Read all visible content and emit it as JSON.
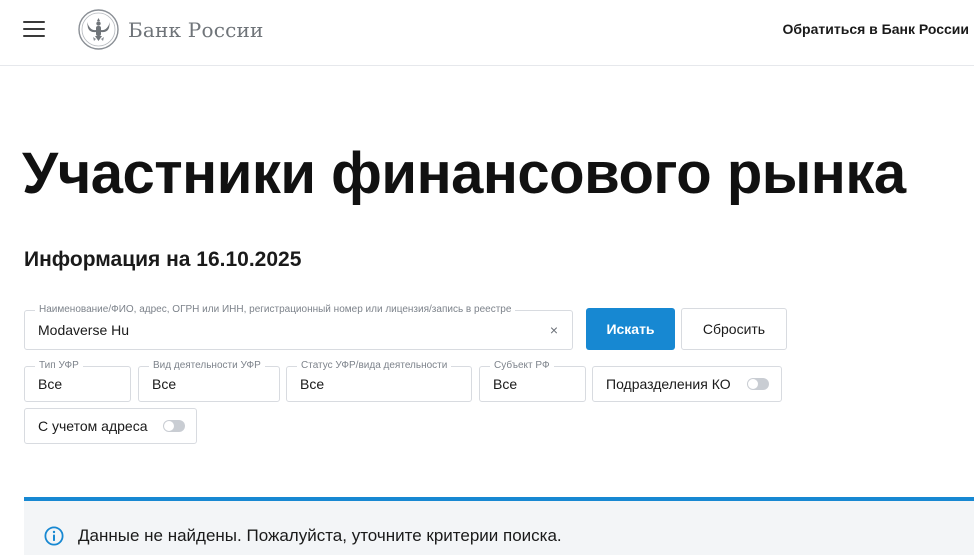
{
  "header": {
    "logo_text": "Банк России",
    "contact_link": "Обратиться в Банк России"
  },
  "main": {
    "title": "Участники финансового рынка",
    "info_date": "Информация на 16.10.2025"
  },
  "search": {
    "legend": "Наименование/ФИО, адрес, ОГРН или ИНН, регистрационный номер или лицензия/запись в реестре",
    "value": "Modaverse Hu",
    "clear_symbol": "×",
    "search_button": "Искать",
    "reset_button": "Сбросить"
  },
  "filters": {
    "ufr_type": {
      "legend": "Тип УФР",
      "value": "Все"
    },
    "activity_type": {
      "legend": "Вид деятельности УФР",
      "value": "Все"
    },
    "status": {
      "legend": "Статус УФР/вида деятельности",
      "value": "Все"
    },
    "subject": {
      "legend": "Субъект РФ",
      "value": "Все"
    },
    "ko_divisions": {
      "label": "Подразделения КО",
      "enabled": false
    },
    "with_address": {
      "label": "С учетом адреса",
      "enabled": false
    }
  },
  "notice": {
    "text": "Данные не найдены. Пожалуйста, уточните критерии поиска.",
    "accent_color": "#1788d2"
  },
  "colors": {
    "primary": "#1788d2",
    "border": "#d8dbe0",
    "notice_bg": "#f3f5f7"
  }
}
